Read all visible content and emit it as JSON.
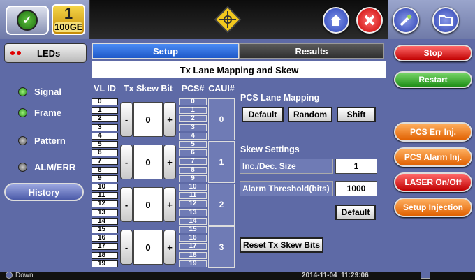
{
  "header": {
    "rate_number": "1",
    "rate_label": "100GE"
  },
  "sidebar": {
    "leds_label": "LEDs",
    "items": [
      {
        "label": "Signal",
        "state": "green"
      },
      {
        "label": "Frame",
        "state": "green"
      },
      {
        "label": "Pattern",
        "state": "grey"
      },
      {
        "label": "ALM/ERR",
        "state": "grey"
      }
    ],
    "history_label": "History"
  },
  "tabs": {
    "setup": "Setup",
    "results": "Results"
  },
  "section_title": "Tx Lane Mapping and Skew",
  "table": {
    "headers": {
      "vl_id": "VL ID",
      "tx_skew_bit": "Tx Skew Bit",
      "pcs": "PCS#",
      "caui": "CAUI#"
    },
    "vl_ids": [
      "0",
      "1",
      "2",
      "3",
      "4",
      "5",
      "6",
      "7",
      "8",
      "9",
      "10",
      "11",
      "12",
      "13",
      "14",
      "15",
      "16",
      "17",
      "18",
      "19"
    ],
    "pcs_ids": [
      "0",
      "1",
      "2",
      "3",
      "4",
      "5",
      "6",
      "7",
      "8",
      "9",
      "10",
      "11",
      "12",
      "13",
      "14",
      "15",
      "16",
      "17",
      "18",
      "19"
    ],
    "groups": [
      {
        "skew": "0",
        "caui": "0"
      },
      {
        "skew": "0",
        "caui": "1"
      },
      {
        "skew": "0",
        "caui": "2"
      },
      {
        "skew": "0",
        "caui": "3"
      }
    ],
    "minus_label": "-",
    "plus_label": "+"
  },
  "pcs_lane_mapping": {
    "title": "PCS Lane Mapping",
    "default_label": "Default",
    "random_label": "Random",
    "shift_label": "Shift"
  },
  "skew_settings": {
    "title": "Skew Settings",
    "inc_dec_label": "Inc./Dec. Size",
    "inc_dec_value": "1",
    "alarm_threshold_label": "Alarm Threshold(bits)",
    "alarm_threshold_value": "1000",
    "default_label": "Default"
  },
  "reset_label": "Reset Tx Skew Bits",
  "right_panel": {
    "stop": "Stop",
    "restart": "Restart",
    "pcs_err_inj": "PCS Err Inj.",
    "pcs_alarm_inj": "PCS Alarm Inj.",
    "laser_onoff": "LASER On/Off",
    "setup_injection": "Setup Injection"
  },
  "status": {
    "link_state": "Down",
    "datetime": "2014-11-04  11:29:06"
  },
  "colors": {
    "panel": "#5e6aa6",
    "tab_active": "#1e58c8",
    "stop_red": "#c00000",
    "restart_green": "#1f8f17",
    "inj_orange": "#e06000"
  }
}
